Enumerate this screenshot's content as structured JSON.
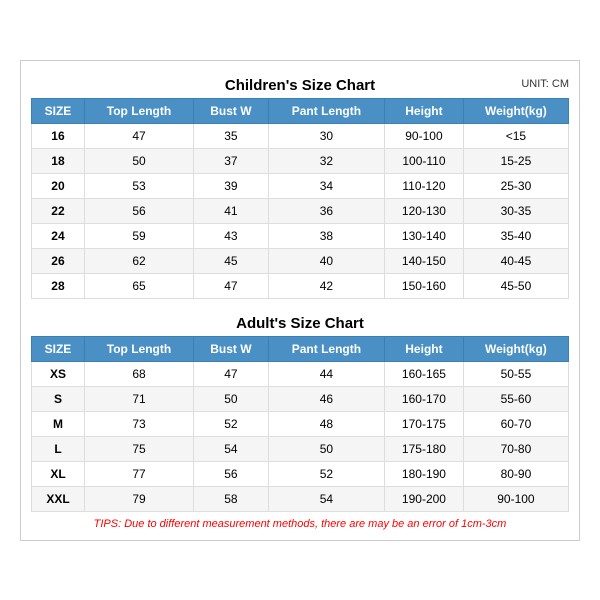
{
  "children_title": "Children's Size Chart",
  "adults_title": "Adult's Size Chart",
  "unit": "UNIT: CM",
  "headers": [
    "SIZE",
    "Top Length",
    "Bust W",
    "Pant Length",
    "Height",
    "Weight(kg)"
  ],
  "children_rows": [
    [
      "16",
      "47",
      "35",
      "30",
      "90-100",
      "<15"
    ],
    [
      "18",
      "50",
      "37",
      "32",
      "100-110",
      "15-25"
    ],
    [
      "20",
      "53",
      "39",
      "34",
      "110-120",
      "25-30"
    ],
    [
      "22",
      "56",
      "41",
      "36",
      "120-130",
      "30-35"
    ],
    [
      "24",
      "59",
      "43",
      "38",
      "130-140",
      "35-40"
    ],
    [
      "26",
      "62",
      "45",
      "40",
      "140-150",
      "40-45"
    ],
    [
      "28",
      "65",
      "47",
      "42",
      "150-160",
      "45-50"
    ]
  ],
  "adult_rows": [
    [
      "XS",
      "68",
      "47",
      "44",
      "160-165",
      "50-55"
    ],
    [
      "S",
      "71",
      "50",
      "46",
      "160-170",
      "55-60"
    ],
    [
      "M",
      "73",
      "52",
      "48",
      "170-175",
      "60-70"
    ],
    [
      "L",
      "75",
      "54",
      "50",
      "175-180",
      "70-80"
    ],
    [
      "XL",
      "77",
      "56",
      "52",
      "180-190",
      "80-90"
    ],
    [
      "XXL",
      "79",
      "58",
      "54",
      "190-200",
      "90-100"
    ]
  ],
  "tips": "TIPS: Due to different measurement methods, there are may be an error of 1cm-3cm"
}
